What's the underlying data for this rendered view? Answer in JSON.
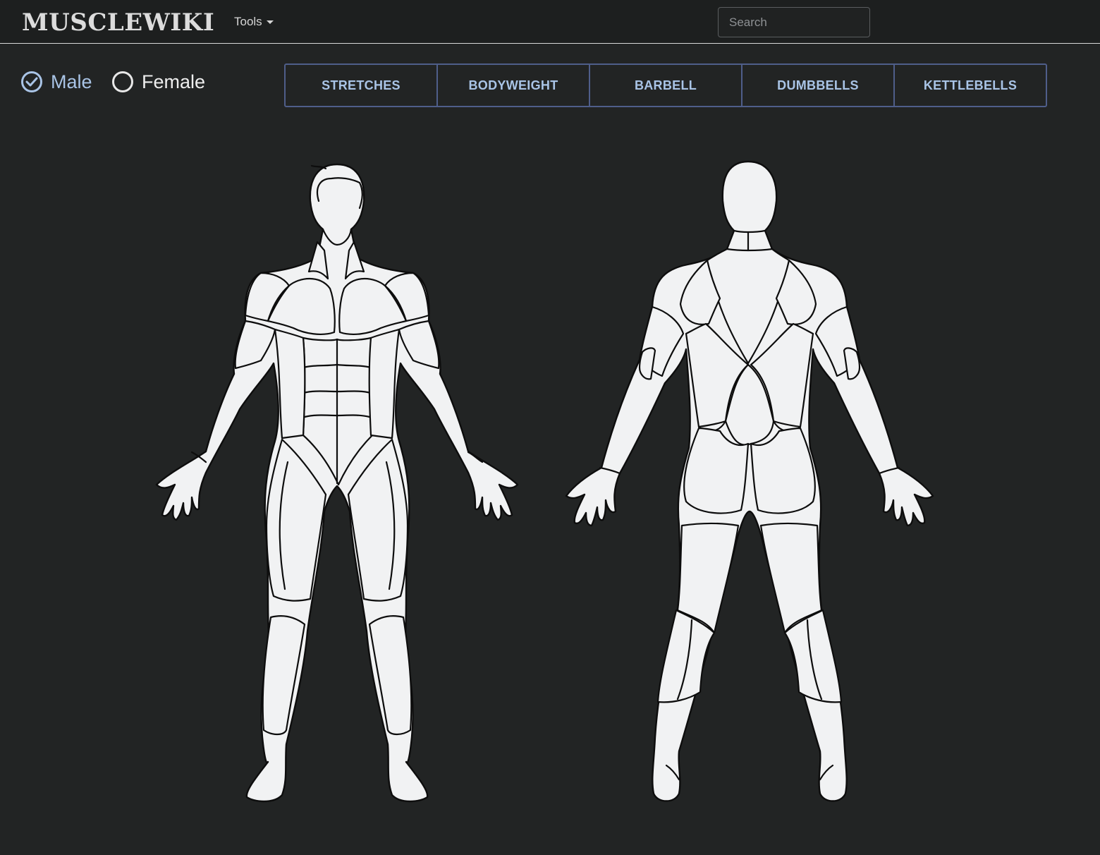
{
  "header": {
    "brand": "MUSCLEWIKI",
    "tools_label": "Tools",
    "search_placeholder": "Search"
  },
  "gender": {
    "male_label": "Male",
    "female_label": "Female",
    "selected": "male"
  },
  "tabs": [
    {
      "label": "STRETCHES"
    },
    {
      "label": "BODYWEIGHT"
    },
    {
      "label": "BARBELL"
    },
    {
      "label": "DUMBBELLS"
    },
    {
      "label": "KETTLEBELLS"
    }
  ],
  "colors": {
    "background": "#222424",
    "accent": "#a9c4e6",
    "tab_border": "#4f5e8a",
    "body_fill": "#f1f2f3"
  },
  "icons": {
    "male_radio": "check-circle-icon",
    "female_radio": "empty-circle-icon",
    "tools_caret": "caret-down-icon"
  }
}
